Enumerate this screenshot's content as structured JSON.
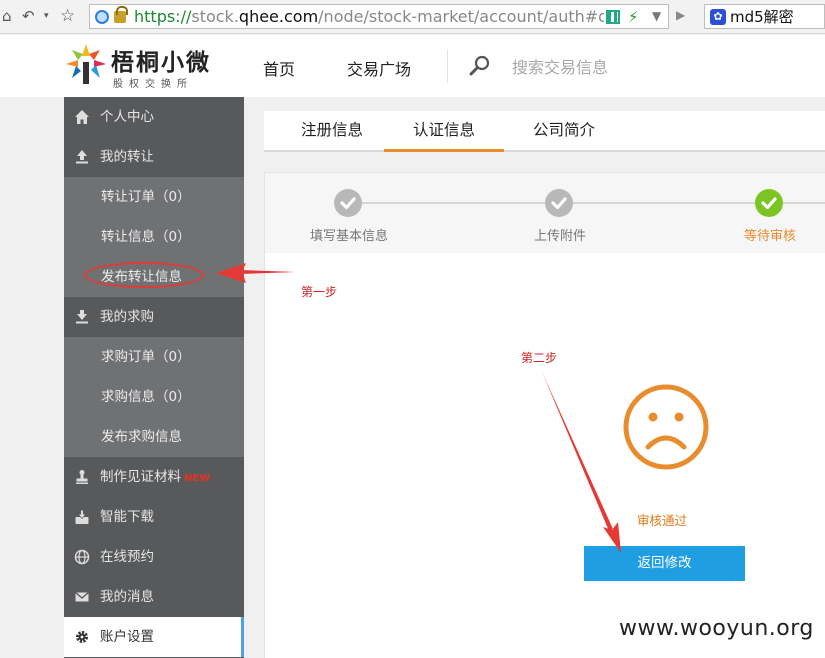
{
  "browser": {
    "url_scheme": "https://",
    "url_host": "stock.",
    "url_domain": "qhee.com",
    "url_path": "/node/stock-market/account/auth#defau",
    "search_engine_label": "md5解密"
  },
  "header": {
    "logo_name": "梧桐小微",
    "logo_subtitle": "股权交换所",
    "nav": [
      "首页",
      "交易广场"
    ],
    "search_placeholder": "搜索交易信息"
  },
  "sidebar": {
    "items": [
      {
        "label": "个人中心",
        "icon": "home-icon"
      },
      {
        "label": "我的转让",
        "icon": "upload-icon"
      },
      {
        "label": "转让订单（0）"
      },
      {
        "label": "转让信息（0）"
      },
      {
        "label": "发布转让信息"
      },
      {
        "label": "我的求购",
        "icon": "download-icon"
      },
      {
        "label": "求购订单（0）"
      },
      {
        "label": "求购信息（0）"
      },
      {
        "label": "发布求购信息"
      },
      {
        "label": "制作见证材料",
        "icon": "stamp-icon",
        "badge": "NEW"
      },
      {
        "label": "智能下载",
        "icon": "download-tray-icon"
      },
      {
        "label": "在线预约",
        "icon": "globe-icon"
      },
      {
        "label": "我的消息",
        "icon": "envelope-icon"
      },
      {
        "label": "账户设置",
        "icon": "gear-icon"
      }
    ]
  },
  "tabs": [
    {
      "label": "注册信息",
      "active": false
    },
    {
      "label": "认证信息",
      "active": true
    },
    {
      "label": "公司简介",
      "active": false
    }
  ],
  "steps": [
    {
      "label": "填写基本信息",
      "state": "completed"
    },
    {
      "label": "上传附件",
      "state": "completed"
    },
    {
      "label": "等待审核",
      "state": "current"
    }
  ],
  "result": {
    "status_text": "审核通过",
    "back_button_label": "返回修改"
  },
  "annotations": {
    "step1": "第一步",
    "step2": "第二步"
  },
  "watermark": "www.wooyun.org",
  "colors": {
    "sidebar_bg": "#58595b",
    "accent_orange": "#e88c2d",
    "button_blue": "#1f9ee3",
    "step_done_green": "#7cc424",
    "annotation_red": "#e53935"
  }
}
